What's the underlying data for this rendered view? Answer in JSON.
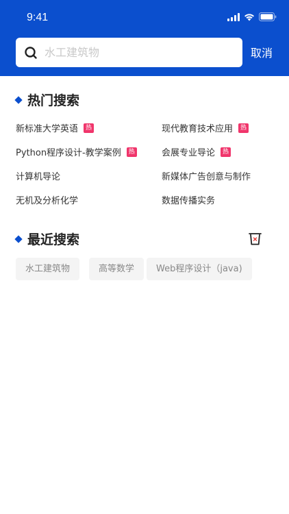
{
  "status": {
    "time": "9:41"
  },
  "search": {
    "placeholder": "水工建筑物",
    "value": "",
    "cancel_label": "取消"
  },
  "hot": {
    "title": "热门搜索",
    "badge": "热",
    "items": [
      {
        "label": "新标准大学英语",
        "hot": true
      },
      {
        "label": "现代教育技术应用",
        "hot": true
      },
      {
        "label": "Python程序设计-教学案例",
        "hot": true
      },
      {
        "label": "会展专业导论",
        "hot": true
      },
      {
        "label": "计算机导论",
        "hot": false
      },
      {
        "label": "新媒体广告创意与制作",
        "hot": false
      },
      {
        "label": "无机及分析化学",
        "hot": false
      },
      {
        "label": "数据传播实务",
        "hot": false
      }
    ]
  },
  "recent": {
    "title": "最近搜索",
    "items": [
      "水工建筑物",
      "高等数学",
      "Web程序设计（java)"
    ]
  },
  "colors": {
    "brand": "#0b4fce",
    "badge": "#f0356b",
    "trash_accent": "#e53935"
  }
}
